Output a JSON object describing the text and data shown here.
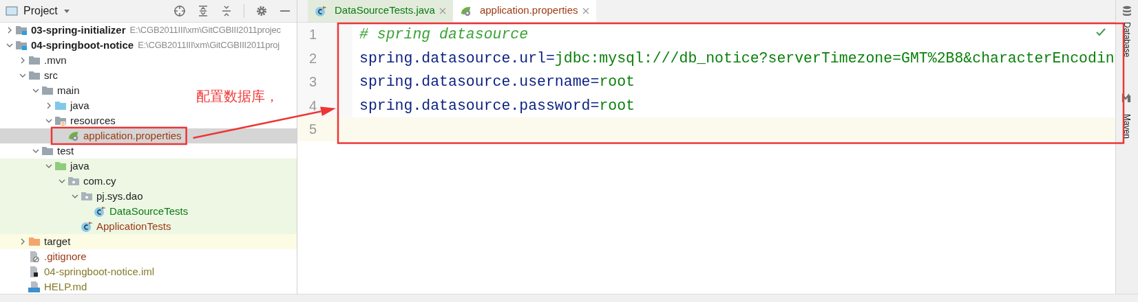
{
  "project_panel": {
    "title": "Project",
    "tree": [
      {
        "name": "03-spring-initializer",
        "kind": "module",
        "path": "E:\\CGB2011III\\xm\\GitCGBIII2011projec",
        "expanded": false,
        "selected": false
      },
      {
        "name": "04-springboot-notice",
        "kind": "module",
        "path": "E:\\CGB2011III\\xm\\GitCGBIII2011proj",
        "expanded": true,
        "selected": false,
        "children": [
          {
            "name": ".mvn",
            "kind": "folder",
            "expanded": false,
            "selected": false
          },
          {
            "name": "src",
            "kind": "folder",
            "expanded": true,
            "selected": false,
            "children": [
              {
                "name": "main",
                "kind": "folder",
                "expanded": true,
                "selected": false,
                "children": [
                  {
                    "name": "java",
                    "kind": "source-folder",
                    "expanded": false,
                    "selected": false
                  },
                  {
                    "name": "resources",
                    "kind": "resources-folder",
                    "expanded": true,
                    "selected": false,
                    "children": [
                      {
                        "name": "application.properties",
                        "kind": "properties-file",
                        "color": "#9c3a12",
                        "selected": true
                      }
                    ]
                  }
                ]
              },
              {
                "name": "test",
                "kind": "folder",
                "expanded": true,
                "selected": false,
                "children": [
                  {
                    "name": "java",
                    "kind": "test-folder",
                    "expanded": true,
                    "selected": false,
                    "children": [
                      {
                        "name": "com.cy",
                        "kind": "package",
                        "expanded": true,
                        "selected": false,
                        "children": [
                          {
                            "name": "pj.sys.dao",
                            "kind": "package",
                            "expanded": true,
                            "selected": false,
                            "children": [
                              {
                                "name": "DataSourceTests",
                                "kind": "test-class",
                                "color": "#0a7a10",
                                "selected": false
                              }
                            ]
                          },
                          {
                            "name": "ApplicationTests",
                            "kind": "test-class",
                            "color": "#9c3a12",
                            "selected": false
                          }
                        ]
                      }
                    ]
                  }
                ]
              }
            ]
          },
          {
            "name": "target",
            "kind": "excluded-folder",
            "expanded": false,
            "selected": false
          },
          {
            "name": ".gitignore",
            "kind": "ignore-file",
            "color": "#9c3a12",
            "selected": false
          },
          {
            "name": "04-springboot-notice.iml",
            "kind": "iml-file",
            "color": "#847a2a",
            "selected": false
          },
          {
            "name": "HELP.md",
            "kind": "markdown-file",
            "color": "#847a2a",
            "selected": false
          }
        ]
      }
    ]
  },
  "editor": {
    "tabs": [
      {
        "label": "DataSourceTests.java",
        "kind": "test-class",
        "color": "#0a7a10",
        "selected": false
      },
      {
        "label": "application.properties",
        "kind": "properties-file",
        "color": "#9c3a12",
        "selected": true
      }
    ],
    "lines": [
      {
        "number": "1",
        "current": false,
        "tokens": [
          {
            "kind": "comment",
            "text": "# spring datasource"
          }
        ]
      },
      {
        "number": "2",
        "current": false,
        "tokens": [
          {
            "kind": "key",
            "text": "spring.datasource.url"
          },
          {
            "kind": "separator",
            "text": "="
          },
          {
            "kind": "value",
            "text": "jdbc:mysql:///db_notice?serverTimezone=GMT%2B8&characterEncodin"
          }
        ]
      },
      {
        "number": "3",
        "current": false,
        "tokens": [
          {
            "kind": "key",
            "text": "spring.datasource.username"
          },
          {
            "kind": "separator",
            "text": "="
          },
          {
            "kind": "value",
            "text": "root"
          }
        ]
      },
      {
        "number": "4",
        "current": false,
        "tokens": [
          {
            "kind": "key",
            "text": "spring.datasource.password"
          },
          {
            "kind": "separator",
            "text": "="
          },
          {
            "kind": "value",
            "text": "root"
          }
        ]
      },
      {
        "number": "5",
        "current": true
      }
    ]
  },
  "tool_strip": {
    "items": [
      "Database",
      "Maven"
    ]
  },
  "annotation": {
    "text": "配置数据库，"
  }
}
